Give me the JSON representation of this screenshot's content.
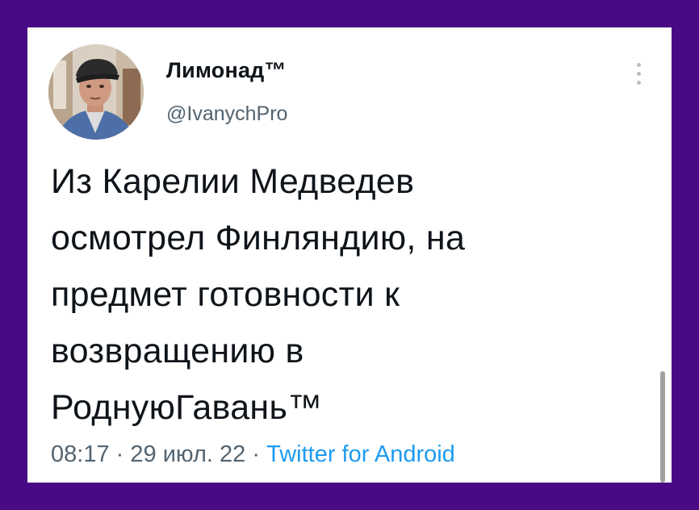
{
  "tweet": {
    "author": {
      "name": "Лимонад™",
      "handle": "@IvanychPro"
    },
    "text": "Из Карелии Медведев\nосмотрел Финляндию, на\nпредмет готовности к\nвозвращению в\nРоднуюГавань™",
    "meta": {
      "time": "08:17",
      "separator": "·",
      "date": "29 июл. 22",
      "source": "Twitter for Android"
    }
  },
  "icons": {
    "more": "more-vertical-icon"
  },
  "colors": {
    "frame": "#4a0a86",
    "text": "#0f1419",
    "muted": "#536471",
    "link": "#1d9bf0"
  }
}
